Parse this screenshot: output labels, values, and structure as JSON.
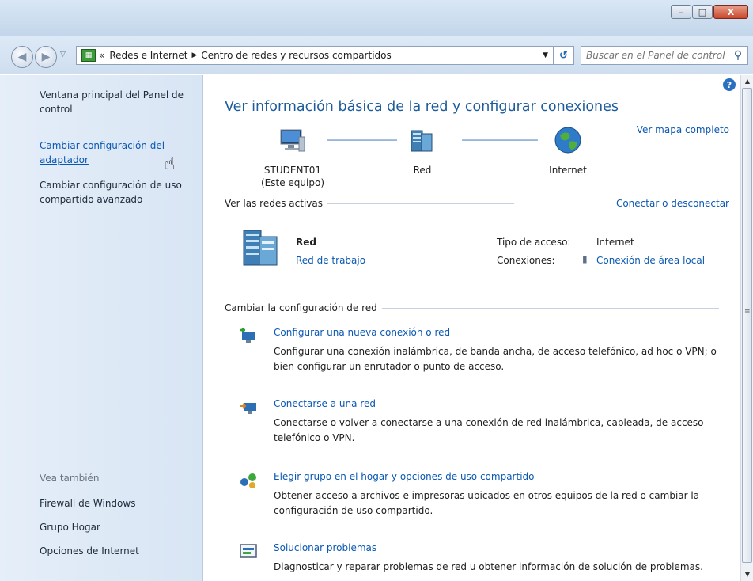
{
  "window": {
    "minimize_label": "–",
    "maximize_label": "□",
    "close_label": "X"
  },
  "navigation": {
    "back_icon": "back-arrow-icon",
    "forward_icon": "forward-arrow-icon",
    "chevron": "«",
    "breadcrumbs": [
      "Redes e Internet",
      "Centro de redes y recursos compartidos"
    ],
    "search_placeholder": "Buscar en el Panel de control"
  },
  "sidebar": {
    "main_link": "Ventana principal del Panel de control",
    "adapter_link": "Cambiar configuración del adaptador",
    "sharing_link": "Cambiar configuración de uso compartido avanzado",
    "see_also_heading": "Vea también",
    "see_also": [
      "Firewall de Windows",
      "Grupo Hogar",
      "Opciones de Internet"
    ]
  },
  "main": {
    "title": "Ver información básica de la red y configurar conexiones",
    "full_map_link": "Ver mapa completo",
    "map_nodes": [
      {
        "label": "STUDENT01",
        "sublabel": "(Este equipo)"
      },
      {
        "label": "Red",
        "sublabel": ""
      },
      {
        "label": "Internet",
        "sublabel": ""
      }
    ],
    "active_networks_heading": "Ver las redes activas",
    "connect_disconnect_link": "Conectar o desconectar",
    "network": {
      "name": "Red",
      "type_link": "Red de trabajo",
      "access_type_label": "Tipo de acceso:",
      "access_type_value": "Internet",
      "connections_label": "Conexiones:",
      "connections_value": "Conexión de área local"
    },
    "change_settings_heading": "Cambiar la configuración de red",
    "tasks": [
      {
        "title": "Configurar una nueva conexión o red",
        "desc": "Configurar una conexión inalámbrica, de banda ancha, de acceso telefónico, ad hoc o VPN; o bien configurar un enrutador o punto de acceso."
      },
      {
        "title": "Conectarse a una red",
        "desc": "Conectarse o volver a conectarse a una conexión de red inalámbrica, cableada, de acceso telefónico o VPN."
      },
      {
        "title": "Elegir grupo en el hogar y opciones de uso compartido",
        "desc": "Obtener acceso a archivos e impresoras ubicados en otros equipos de la red o cambiar la configuración de uso compartido."
      },
      {
        "title": "Solucionar problemas",
        "desc": "Diagnosticar y reparar problemas de red u obtener información de solución de problemas."
      }
    ]
  }
}
